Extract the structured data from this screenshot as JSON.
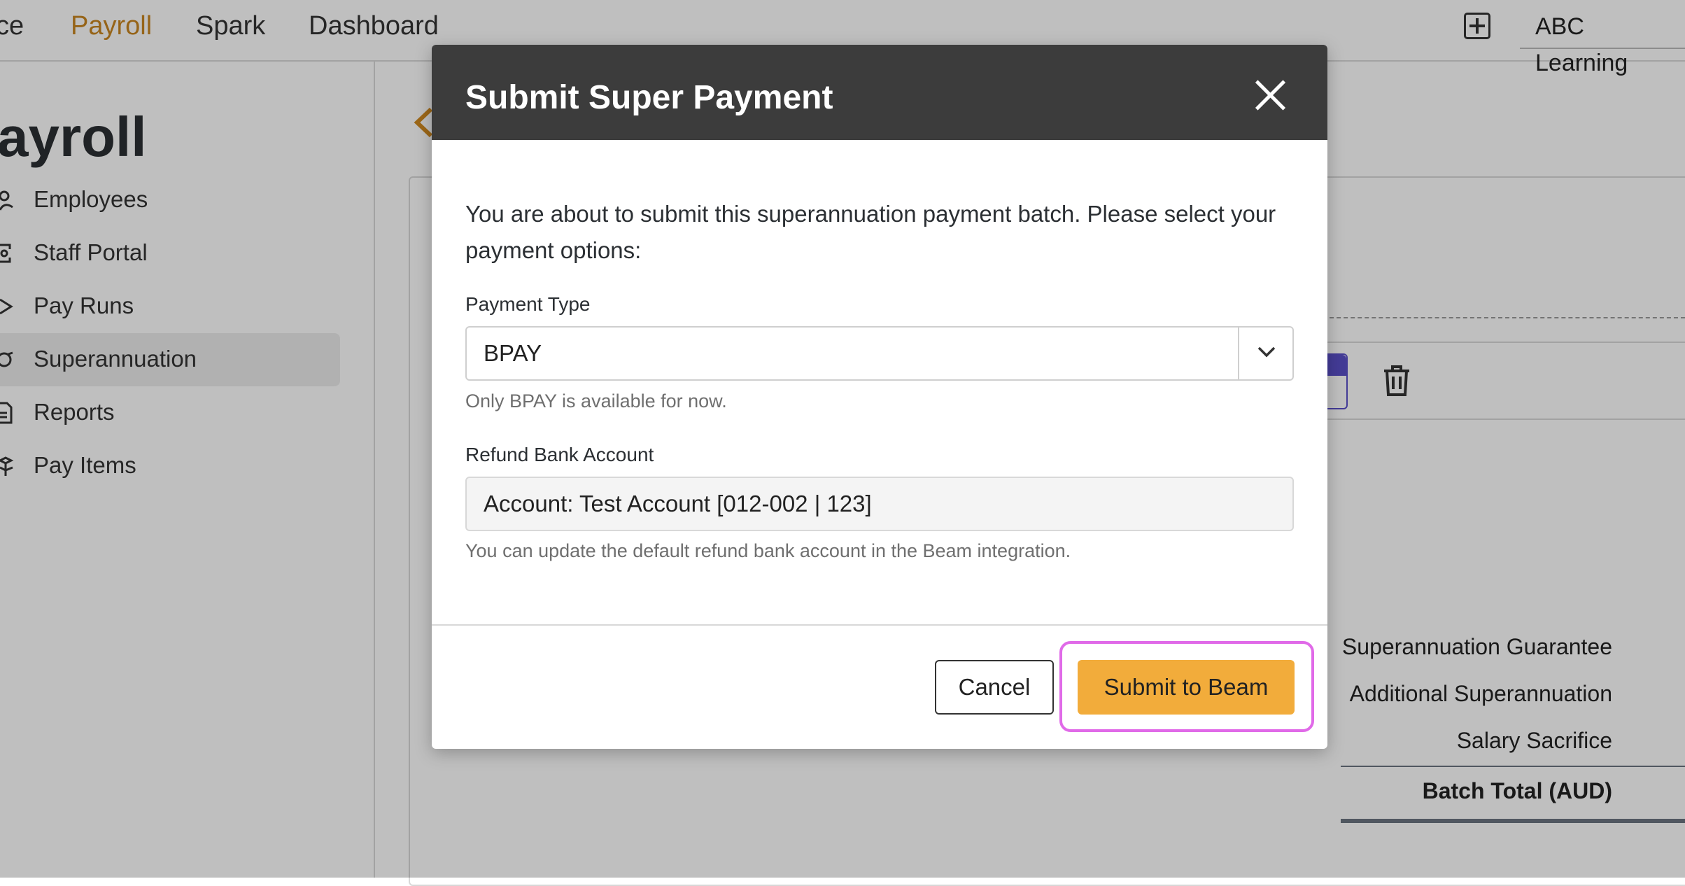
{
  "topnav": {
    "items": [
      {
        "label": "ce",
        "active": false
      },
      {
        "label": "Payroll",
        "active": true
      },
      {
        "label": "Spark",
        "active": false
      },
      {
        "label": "Dashboard",
        "active": false
      }
    ],
    "add_icon": "plus-square-icon",
    "org_name": "ABC Learning"
  },
  "sidebar": {
    "title": "ayroll",
    "items": [
      {
        "label": "Employees",
        "icon": "users-icon",
        "active": false
      },
      {
        "label": "Staff Portal",
        "icon": "portal-icon",
        "active": false
      },
      {
        "label": "Pay Runs",
        "icon": "chevron-right-icon",
        "active": false
      },
      {
        "label": "Superannuation",
        "icon": "piggy-bank-icon",
        "active": true
      },
      {
        "label": "Reports",
        "icon": "document-icon",
        "active": false
      },
      {
        "label": "Pay Items",
        "icon": "cubes-icon",
        "active": false
      }
    ]
  },
  "background_summary": {
    "rows": [
      "Superannuation Guarantee",
      "Additional Superannuation",
      "Salary Sacrifice"
    ],
    "total_label": "Batch Total (AUD)"
  },
  "modal": {
    "title": "Submit Super Payment",
    "intro": "You are about to submit this superannuation payment batch. Please select your payment options:",
    "payment_type": {
      "label": "Payment Type",
      "value": "BPAY",
      "help": "Only BPAY is available for now."
    },
    "refund_account": {
      "label": "Refund Bank Account",
      "value": "Account: Test Account [012-002 | 123]",
      "help": "You can update the default refund bank account in the Beam integration."
    },
    "cancel_label": "Cancel",
    "submit_label": "Submit to Beam"
  },
  "colors": {
    "accent": "#f2ac3b",
    "nav_active": "#c98620",
    "header_bg": "#3c3c3c",
    "highlight": "#e06ae8"
  }
}
